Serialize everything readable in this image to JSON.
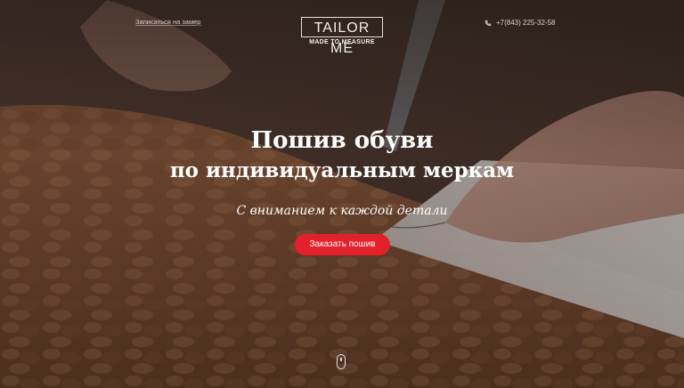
{
  "header": {
    "signup_link": "Записаться на замер",
    "logo": {
      "title": "TAILOR ME",
      "subtitle": "MADE TO MEASURE"
    },
    "phone": {
      "icon": "phone-icon",
      "number": "+7(843) 225-32-58"
    }
  },
  "hero": {
    "headline_line1": "Пошив обуви",
    "headline_line2": "по индивидуальным меркам",
    "subtitle": "С вниманием к каждой детали",
    "cta_label": "Заказать пошив",
    "scroll_icon": "mouse-scroll-icon"
  },
  "colors": {
    "accent": "#e3212b",
    "text": "#ffffff"
  }
}
